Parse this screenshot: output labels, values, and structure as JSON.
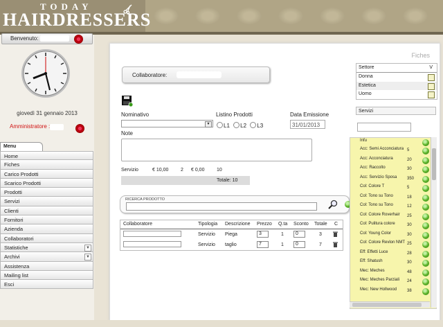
{
  "header": {
    "logo_top": "TODAY",
    "logo_main": "HAIRDRESSERS"
  },
  "sidebar": {
    "welcome_label": "Benvenuto:",
    "date": "giovedì 31 gennaio 2013",
    "admin_label": "Amministratore :",
    "menu_tab": "Menu",
    "menu_items": [
      {
        "label": "Home"
      },
      {
        "label": "Fiches"
      },
      {
        "label": "Carico Prodotti"
      },
      {
        "label": "Scarico Prodotti"
      },
      {
        "label": "Prodotti"
      },
      {
        "label": "Servizi"
      },
      {
        "label": "Clienti"
      },
      {
        "label": "Fornitori"
      },
      {
        "label": "Azienda"
      },
      {
        "label": "Collaboratori"
      },
      {
        "label": "Statistiche",
        "expand": true
      },
      {
        "label": "Archivi",
        "expand": true
      },
      {
        "label": "Assistenza"
      },
      {
        "label": "Mailing list"
      },
      {
        "label": "Esci"
      }
    ]
  },
  "main": {
    "title": "Fiches",
    "collaboratore_label": "Collaboratore:",
    "nominativo_label": "Nominativo",
    "listino_label": "Listino Prodotti",
    "listino_options": [
      "L1",
      "L2",
      "L3"
    ],
    "data_emissione_label": "Data Emissione",
    "data_emissione_value": "31/01/2013",
    "note_label": "Note",
    "summary": {
      "tipo": "Servizio",
      "importo": "€ 10,00",
      "qta": "2",
      "sconto": "€ 0,00",
      "totale": "10",
      "totale_label": "Totale: 10"
    },
    "ricerca_label": "RICERCA PRODOTTO",
    "table": {
      "headers": [
        "Collaboratore",
        "Tipologia",
        "Descrizione",
        "Prezzo",
        "Q.ta",
        "Sconto",
        "Totale",
        "C"
      ],
      "rows": [
        {
          "tipologia": "Servizio",
          "descrizione": "Piega",
          "prezzo": "3",
          "qta": "1",
          "sconto": "0",
          "totale": "3"
        },
        {
          "tipologia": "Servizio",
          "descrizione": "taglio",
          "prezzo": "7",
          "qta": "1",
          "sconto": "0",
          "totale": "7"
        }
      ]
    }
  },
  "settore": {
    "header": "Settore",
    "header_v": "V",
    "items": [
      "Donna",
      "Estetica",
      "Uomo"
    ]
  },
  "servizi": {
    "header": "Servizi",
    "items": [
      {
        "name": "Infu",
        "price": ""
      },
      {
        "name": "Acc: Semi Acconciatura",
        "price": "5"
      },
      {
        "name": "Acc: Acconciatura",
        "price": "20"
      },
      {
        "name": "Acc: Raccolto",
        "price": "30"
      },
      {
        "name": "Acc: Servizio Sposa",
        "price": "350"
      },
      {
        "name": "Col: Colore T",
        "price": "5"
      },
      {
        "name": "Col: Tono su Tono",
        "price": "18"
      },
      {
        "name": "Col: Tono su Tono",
        "price": "12"
      },
      {
        "name": "Col: Colore Roverhair",
        "price": "25"
      },
      {
        "name": "Col: Pulitura colore",
        "price": "30"
      },
      {
        "name": "Col: Young Color",
        "price": "30"
      },
      {
        "name": "Col: Colore Revlon NMT",
        "price": "25"
      },
      {
        "name": "Eff: Effetti Luce",
        "price": "28"
      },
      {
        "name": "Eff: Shatush",
        "price": "30"
      },
      {
        "name": "Mec: Meches",
        "price": "48"
      },
      {
        "name": "Mec: Meches Parziali",
        "price": "24"
      },
      {
        "name": "Mec: New Hollwood",
        "price": "38"
      }
    ]
  },
  "colors": {
    "accent_red": "#d01010",
    "list_bg": "#f7f5ac",
    "header_bg": "#9a8f74",
    "green": "#5fb52b"
  }
}
